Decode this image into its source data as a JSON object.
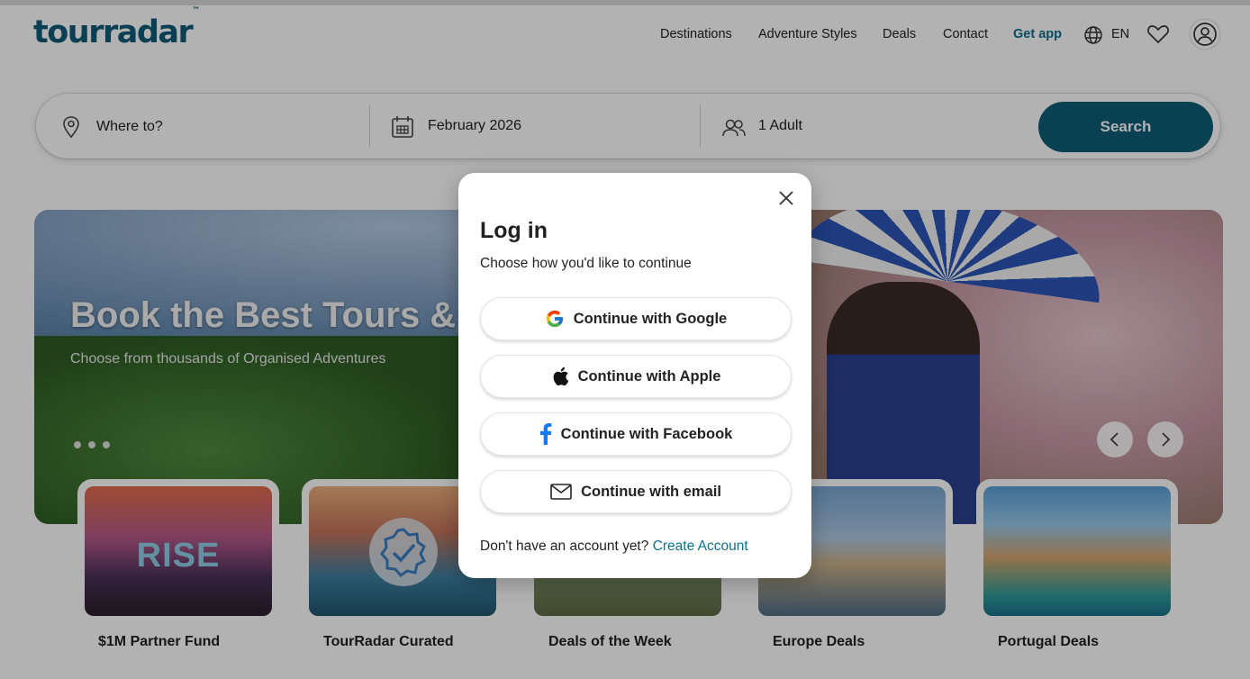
{
  "header": {
    "logo": "tourradar",
    "logo_tm": "™",
    "nav": [
      "Destinations",
      "Adventure Styles",
      "Deals",
      "Contact"
    ],
    "get_app": "Get app",
    "language": "EN"
  },
  "search": {
    "where": "Where to?",
    "date": "February 2026",
    "travelers": "1 Adult",
    "button": "Search"
  },
  "hero": {
    "title": "Book the Best Tours & Adventures",
    "subtitle": "Choose from thousands of Organised Adventures",
    "slides": 3
  },
  "cards": [
    {
      "label": "$1M Partner Fund",
      "art": "RISE"
    },
    {
      "label": "TourRadar Curated"
    },
    {
      "label": "Deals of the Week"
    },
    {
      "label": "Europe Deals"
    },
    {
      "label": "Portugal Deals"
    }
  ],
  "modal": {
    "title": "Log in",
    "subtitle": "Choose how you'd like to continue",
    "buttons": {
      "google": "Continue with Google",
      "apple": "Continue with Apple",
      "facebook": "Continue with Facebook",
      "email": "Continue with email"
    },
    "footer_text": "Don't have an account yet?",
    "footer_link": "Create Account"
  },
  "colors": {
    "brand": "#0d5c76",
    "link": "#0d6f8f",
    "facebook": "#1877f2"
  }
}
